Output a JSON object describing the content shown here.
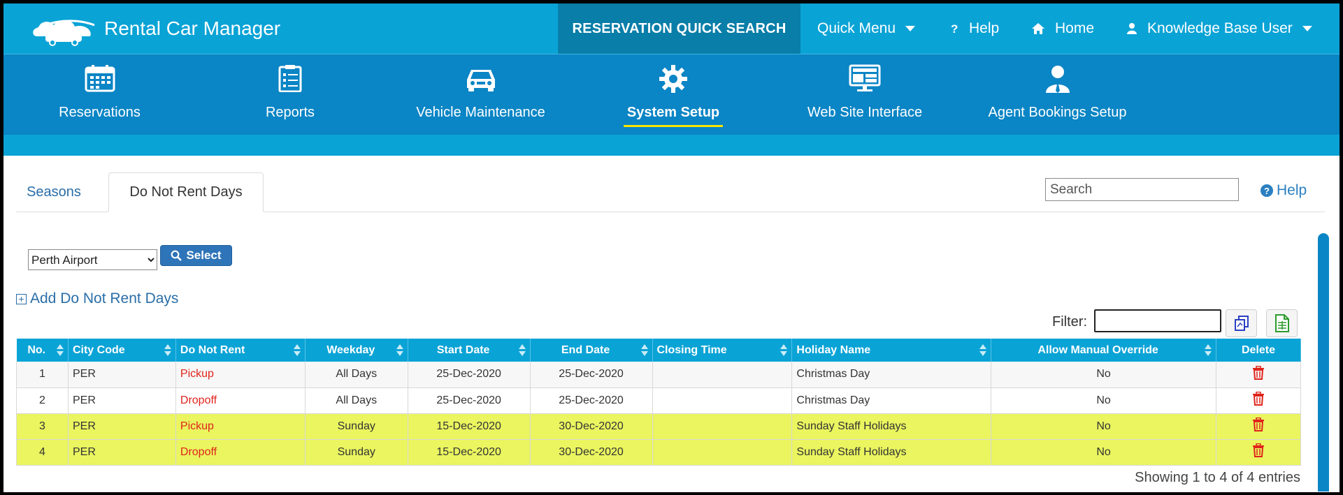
{
  "app": {
    "title": "Rental Car Manager",
    "quick_search": "RESERVATION QUICK SEARCH",
    "top_links": {
      "quick_menu": "Quick Menu",
      "help": "Help",
      "home": "Home",
      "user": "Knowledge Base User"
    }
  },
  "nav": {
    "reservations": "Reservations",
    "reports": "Reports",
    "vehicle_maintenance": "Vehicle Maintenance",
    "system_setup": "System Setup",
    "web_site_interface": "Web Site Interface",
    "agent_bookings_setup": "Agent Bookings Setup",
    "active": "System Setup"
  },
  "tabs": {
    "seasons": "Seasons",
    "do_not_rent_days": "Do Not Rent Days",
    "active": "Do Not Rent Days"
  },
  "search": {
    "placeholder": "Search"
  },
  "help_link": "Help",
  "location": {
    "selected": "Perth Airport",
    "button": "Select"
  },
  "add_link": "Add Do Not Rent Days",
  "filter": {
    "label": "Filter:",
    "value": ""
  },
  "table": {
    "columns": {
      "no": "No.",
      "city_code": "City Code",
      "do_not_rent": "Do Not Rent",
      "weekday": "Weekday",
      "start_date": "Start Date",
      "end_date": "End Date",
      "closing_time": "Closing Time",
      "holiday_name": "Holiday Name",
      "allow_manual_override": "Allow Manual Override",
      "delete": "Delete"
    },
    "rows": [
      {
        "no": "1",
        "city": "PER",
        "dnr": "Pickup",
        "weekday": "All Days",
        "start": "25-Dec-2020",
        "end": "25-Dec-2020",
        "closing": "",
        "holiday": "Christmas Day",
        "override": "No",
        "highlighted": false
      },
      {
        "no": "2",
        "city": "PER",
        "dnr": "Dropoff",
        "weekday": "All Days",
        "start": "25-Dec-2020",
        "end": "25-Dec-2020",
        "closing": "",
        "holiday": "Christmas Day",
        "override": "No",
        "highlighted": false
      },
      {
        "no": "3",
        "city": "PER",
        "dnr": "Pickup",
        "weekday": "Sunday",
        "start": "15-Dec-2020",
        "end": "30-Dec-2020",
        "closing": "",
        "holiday": "Sunday Staff Holidays",
        "override": "No",
        "highlighted": true
      },
      {
        "no": "4",
        "city": "PER",
        "dnr": "Dropoff",
        "weekday": "Sunday",
        "start": "15-Dec-2020",
        "end": "30-Dec-2020",
        "closing": "",
        "holiday": "Sunday Staff Holidays",
        "override": "No",
        "highlighted": true
      }
    ],
    "showing": "Showing 1 to 4 of 4 entries"
  },
  "colors": {
    "topbar": "#0aa3d6",
    "navbar": "#0a85c5",
    "quick_search_bg": "#087ea8",
    "active_underline": "#f5e400",
    "highlight_row": "#eaf55f",
    "do_not_rent_text": "#e0241b",
    "delete_icon": "#e0241b"
  },
  "icons": {
    "logo": "car-cloud-logo",
    "quick_menu_caret": "chevron-down-icon",
    "help": "question-icon",
    "home": "home-icon",
    "user": "user-icon",
    "reservations": "calendar-icon",
    "reports": "clipboard-icon",
    "vehicle_maintenance": "car-icon",
    "system_setup": "gear-icon",
    "web_site_interface": "monitor-icon",
    "agent_bookings_setup": "agent-icon",
    "select": "search-icon",
    "add": "plus-square-icon",
    "copy": "copy-icon",
    "export": "spreadsheet-icon",
    "delete": "trash-icon"
  }
}
